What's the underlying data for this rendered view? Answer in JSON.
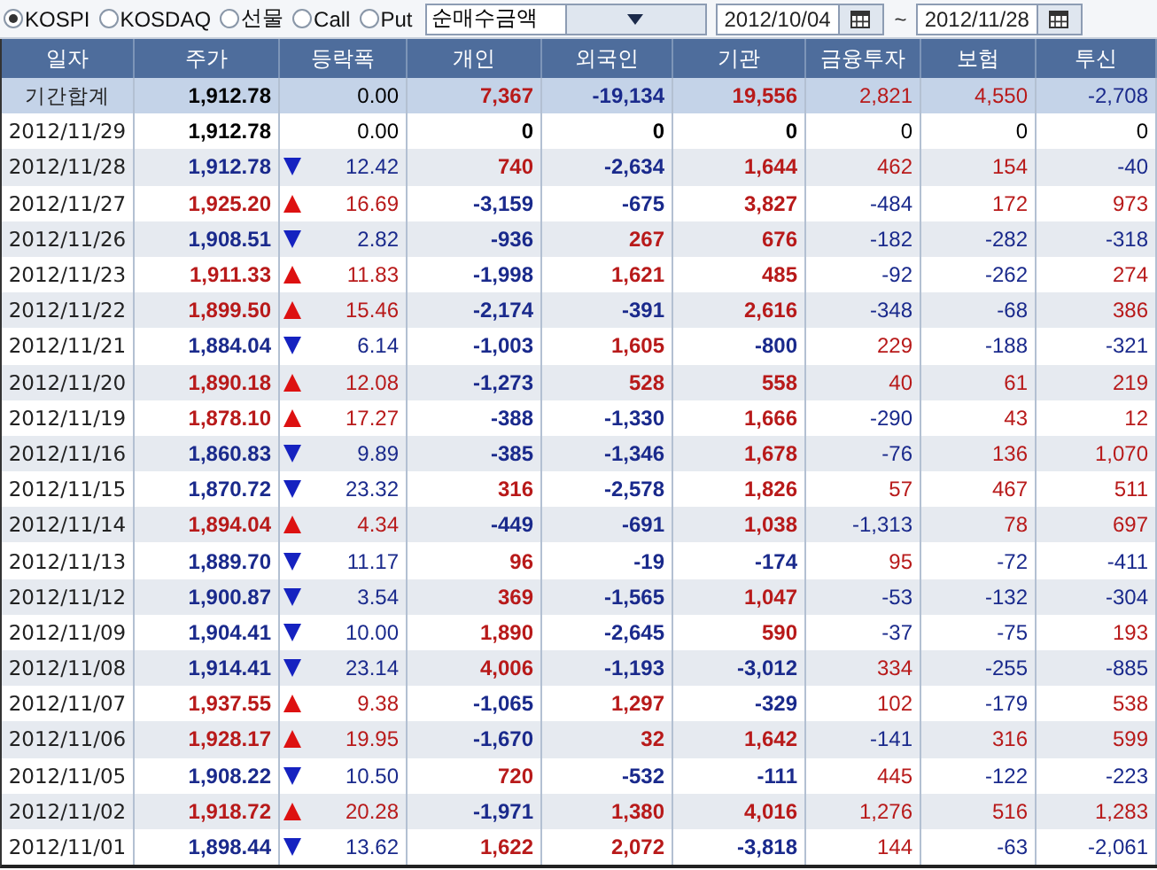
{
  "toolbar": {
    "markets": [
      {
        "label": "KOSPI",
        "selected": true
      },
      {
        "label": "KOSDAQ",
        "selected": false
      },
      {
        "label": "선물",
        "selected": false
      },
      {
        "label": "Call",
        "selected": false
      },
      {
        "label": "Put",
        "selected": false
      }
    ],
    "metric": "순매수금액",
    "date_from": "2012/10/04",
    "range_separator": "~",
    "date_to": "2012/11/28"
  },
  "table": {
    "columns": [
      "일자",
      "주가",
      "등락폭",
      "개인",
      "외국인",
      "기관",
      "금융투자",
      "보험",
      "투신"
    ],
    "rows": [
      {
        "kind": "total",
        "date": "기간합계",
        "price": {
          "value": "1,912.78",
          "color": "#000000"
        },
        "change": {
          "kind": "none",
          "value": "0.00",
          "color": "#000000"
        },
        "investors": [
          {
            "value": "7,367",
            "color": "#b81a1a"
          },
          {
            "value": "-19,134",
            "color": "#1a2a8c"
          },
          {
            "value": "19,556",
            "color": "#b81a1a"
          },
          {
            "value": "2,821",
            "color": "#b81a1a"
          },
          {
            "value": "4,550",
            "color": "#b81a1a"
          },
          {
            "value": "-2,708",
            "color": "#1a2a8c"
          }
        ]
      },
      {
        "kind": "day",
        "date": "2012/11/29",
        "price": {
          "value": "1,912.78",
          "color": "#000000"
        },
        "change": {
          "kind": "none",
          "value": "0.00",
          "color": "#000000"
        },
        "investors": [
          {
            "value": "0",
            "color": "#000000"
          },
          {
            "value": "0",
            "color": "#000000"
          },
          {
            "value": "0",
            "color": "#000000"
          },
          {
            "value": "0",
            "color": "#000000"
          },
          {
            "value": "0",
            "color": "#000000"
          },
          {
            "value": "0",
            "color": "#000000"
          }
        ]
      },
      {
        "kind": "day",
        "date": "2012/11/28",
        "price": {
          "value": "1,912.78",
          "color": "#1a2a8c"
        },
        "change": {
          "kind": "down",
          "value": "12.42",
          "color": "#1a2a8c"
        },
        "investors": [
          {
            "value": "740",
            "color": "#b81a1a"
          },
          {
            "value": "-2,634",
            "color": "#1a2a8c"
          },
          {
            "value": "1,644",
            "color": "#b81a1a"
          },
          {
            "value": "462",
            "color": "#b81a1a"
          },
          {
            "value": "154",
            "color": "#b81a1a"
          },
          {
            "value": "-40",
            "color": "#1a2a8c"
          }
        ]
      },
      {
        "kind": "day",
        "date": "2012/11/27",
        "price": {
          "value": "1,925.20",
          "color": "#b81a1a"
        },
        "change": {
          "kind": "up",
          "value": "16.69",
          "color": "#b81a1a"
        },
        "investors": [
          {
            "value": "-3,159",
            "color": "#1a2a8c"
          },
          {
            "value": "-675",
            "color": "#1a2a8c"
          },
          {
            "value": "3,827",
            "color": "#b81a1a"
          },
          {
            "value": "-484",
            "color": "#1a2a8c"
          },
          {
            "value": "172",
            "color": "#b81a1a"
          },
          {
            "value": "973",
            "color": "#b81a1a"
          }
        ]
      },
      {
        "kind": "day",
        "date": "2012/11/26",
        "price": {
          "value": "1,908.51",
          "color": "#1a2a8c"
        },
        "change": {
          "kind": "down",
          "value": "2.82",
          "color": "#1a2a8c"
        },
        "investors": [
          {
            "value": "-936",
            "color": "#1a2a8c"
          },
          {
            "value": "267",
            "color": "#b81a1a"
          },
          {
            "value": "676",
            "color": "#b81a1a"
          },
          {
            "value": "-182",
            "color": "#1a2a8c"
          },
          {
            "value": "-282",
            "color": "#1a2a8c"
          },
          {
            "value": "-318",
            "color": "#1a2a8c"
          }
        ]
      },
      {
        "kind": "day",
        "date": "2012/11/23",
        "price": {
          "value": "1,911.33",
          "color": "#b81a1a"
        },
        "change": {
          "kind": "up",
          "value": "11.83",
          "color": "#b81a1a"
        },
        "investors": [
          {
            "value": "-1,998",
            "color": "#1a2a8c"
          },
          {
            "value": "1,621",
            "color": "#b81a1a"
          },
          {
            "value": "485",
            "color": "#b81a1a"
          },
          {
            "value": "-92",
            "color": "#1a2a8c"
          },
          {
            "value": "-262",
            "color": "#1a2a8c"
          },
          {
            "value": "274",
            "color": "#b81a1a"
          }
        ]
      },
      {
        "kind": "day",
        "date": "2012/11/22",
        "price": {
          "value": "1,899.50",
          "color": "#b81a1a"
        },
        "change": {
          "kind": "up",
          "value": "15.46",
          "color": "#b81a1a"
        },
        "investors": [
          {
            "value": "-2,174",
            "color": "#1a2a8c"
          },
          {
            "value": "-391",
            "color": "#1a2a8c"
          },
          {
            "value": "2,616",
            "color": "#b81a1a"
          },
          {
            "value": "-348",
            "color": "#1a2a8c"
          },
          {
            "value": "-68",
            "color": "#1a2a8c"
          },
          {
            "value": "386",
            "color": "#b81a1a"
          }
        ]
      },
      {
        "kind": "day",
        "date": "2012/11/21",
        "price": {
          "value": "1,884.04",
          "color": "#1a2a8c"
        },
        "change": {
          "kind": "down",
          "value": "6.14",
          "color": "#1a2a8c"
        },
        "investors": [
          {
            "value": "-1,003",
            "color": "#1a2a8c"
          },
          {
            "value": "1,605",
            "color": "#b81a1a"
          },
          {
            "value": "-800",
            "color": "#1a2a8c"
          },
          {
            "value": "229",
            "color": "#b81a1a"
          },
          {
            "value": "-188",
            "color": "#1a2a8c"
          },
          {
            "value": "-321",
            "color": "#1a2a8c"
          }
        ]
      },
      {
        "kind": "day",
        "date": "2012/11/20",
        "price": {
          "value": "1,890.18",
          "color": "#b81a1a"
        },
        "change": {
          "kind": "up",
          "value": "12.08",
          "color": "#b81a1a"
        },
        "investors": [
          {
            "value": "-1,273",
            "color": "#1a2a8c"
          },
          {
            "value": "528",
            "color": "#b81a1a"
          },
          {
            "value": "558",
            "color": "#b81a1a"
          },
          {
            "value": "40",
            "color": "#b81a1a"
          },
          {
            "value": "61",
            "color": "#b81a1a"
          },
          {
            "value": "219",
            "color": "#b81a1a"
          }
        ]
      },
      {
        "kind": "day",
        "date": "2012/11/19",
        "price": {
          "value": "1,878.10",
          "color": "#b81a1a"
        },
        "change": {
          "kind": "up",
          "value": "17.27",
          "color": "#b81a1a"
        },
        "investors": [
          {
            "value": "-388",
            "color": "#1a2a8c"
          },
          {
            "value": "-1,330",
            "color": "#1a2a8c"
          },
          {
            "value": "1,666",
            "color": "#b81a1a"
          },
          {
            "value": "-290",
            "color": "#1a2a8c"
          },
          {
            "value": "43",
            "color": "#b81a1a"
          },
          {
            "value": "12",
            "color": "#b81a1a"
          }
        ]
      },
      {
        "kind": "day",
        "date": "2012/11/16",
        "price": {
          "value": "1,860.83",
          "color": "#1a2a8c"
        },
        "change": {
          "kind": "down",
          "value": "9.89",
          "color": "#1a2a8c"
        },
        "investors": [
          {
            "value": "-385",
            "color": "#1a2a8c"
          },
          {
            "value": "-1,346",
            "color": "#1a2a8c"
          },
          {
            "value": "1,678",
            "color": "#b81a1a"
          },
          {
            "value": "-76",
            "color": "#1a2a8c"
          },
          {
            "value": "136",
            "color": "#b81a1a"
          },
          {
            "value": "1,070",
            "color": "#b81a1a"
          }
        ]
      },
      {
        "kind": "day",
        "date": "2012/11/15",
        "price": {
          "value": "1,870.72",
          "color": "#1a2a8c"
        },
        "change": {
          "kind": "down",
          "value": "23.32",
          "color": "#1a2a8c"
        },
        "investors": [
          {
            "value": "316",
            "color": "#b81a1a"
          },
          {
            "value": "-2,578",
            "color": "#1a2a8c"
          },
          {
            "value": "1,826",
            "color": "#b81a1a"
          },
          {
            "value": "57",
            "color": "#b81a1a"
          },
          {
            "value": "467",
            "color": "#b81a1a"
          },
          {
            "value": "511",
            "color": "#b81a1a"
          }
        ]
      },
      {
        "kind": "day",
        "date": "2012/11/14",
        "price": {
          "value": "1,894.04",
          "color": "#b81a1a"
        },
        "change": {
          "kind": "up",
          "value": "4.34",
          "color": "#b81a1a"
        },
        "investors": [
          {
            "value": "-449",
            "color": "#1a2a8c"
          },
          {
            "value": "-691",
            "color": "#1a2a8c"
          },
          {
            "value": "1,038",
            "color": "#b81a1a"
          },
          {
            "value": "-1,313",
            "color": "#1a2a8c"
          },
          {
            "value": "78",
            "color": "#b81a1a"
          },
          {
            "value": "697",
            "color": "#b81a1a"
          }
        ]
      },
      {
        "kind": "day",
        "date": "2012/11/13",
        "price": {
          "value": "1,889.70",
          "color": "#1a2a8c"
        },
        "change": {
          "kind": "down",
          "value": "11.17",
          "color": "#1a2a8c"
        },
        "investors": [
          {
            "value": "96",
            "color": "#b81a1a"
          },
          {
            "value": "-19",
            "color": "#1a2a8c"
          },
          {
            "value": "-174",
            "color": "#1a2a8c"
          },
          {
            "value": "95",
            "color": "#b81a1a"
          },
          {
            "value": "-72",
            "color": "#1a2a8c"
          },
          {
            "value": "-411",
            "color": "#1a2a8c"
          }
        ]
      },
      {
        "kind": "day",
        "date": "2012/11/12",
        "price": {
          "value": "1,900.87",
          "color": "#1a2a8c"
        },
        "change": {
          "kind": "down",
          "value": "3.54",
          "color": "#1a2a8c"
        },
        "investors": [
          {
            "value": "369",
            "color": "#b81a1a"
          },
          {
            "value": "-1,565",
            "color": "#1a2a8c"
          },
          {
            "value": "1,047",
            "color": "#b81a1a"
          },
          {
            "value": "-53",
            "color": "#1a2a8c"
          },
          {
            "value": "-132",
            "color": "#1a2a8c"
          },
          {
            "value": "-304",
            "color": "#1a2a8c"
          }
        ]
      },
      {
        "kind": "day",
        "date": "2012/11/09",
        "price": {
          "value": "1,904.41",
          "color": "#1a2a8c"
        },
        "change": {
          "kind": "down",
          "value": "10.00",
          "color": "#1a2a8c"
        },
        "investors": [
          {
            "value": "1,890",
            "color": "#b81a1a"
          },
          {
            "value": "-2,645",
            "color": "#1a2a8c"
          },
          {
            "value": "590",
            "color": "#b81a1a"
          },
          {
            "value": "-37",
            "color": "#1a2a8c"
          },
          {
            "value": "-75",
            "color": "#1a2a8c"
          },
          {
            "value": "193",
            "color": "#b81a1a"
          }
        ]
      },
      {
        "kind": "day",
        "date": "2012/11/08",
        "price": {
          "value": "1,914.41",
          "color": "#1a2a8c"
        },
        "change": {
          "kind": "down",
          "value": "23.14",
          "color": "#1a2a8c"
        },
        "investors": [
          {
            "value": "4,006",
            "color": "#b81a1a"
          },
          {
            "value": "-1,193",
            "color": "#1a2a8c"
          },
          {
            "value": "-3,012",
            "color": "#1a2a8c"
          },
          {
            "value": "334",
            "color": "#b81a1a"
          },
          {
            "value": "-255",
            "color": "#1a2a8c"
          },
          {
            "value": "-885",
            "color": "#1a2a8c"
          }
        ]
      },
      {
        "kind": "day",
        "date": "2012/11/07",
        "price": {
          "value": "1,937.55",
          "color": "#b81a1a"
        },
        "change": {
          "kind": "up",
          "value": "9.38",
          "color": "#b81a1a"
        },
        "investors": [
          {
            "value": "-1,065",
            "color": "#1a2a8c"
          },
          {
            "value": "1,297",
            "color": "#b81a1a"
          },
          {
            "value": "-329",
            "color": "#1a2a8c"
          },
          {
            "value": "102",
            "color": "#b81a1a"
          },
          {
            "value": "-179",
            "color": "#1a2a8c"
          },
          {
            "value": "538",
            "color": "#b81a1a"
          }
        ]
      },
      {
        "kind": "day",
        "date": "2012/11/06",
        "price": {
          "value": "1,928.17",
          "color": "#b81a1a"
        },
        "change": {
          "kind": "up",
          "value": "19.95",
          "color": "#b81a1a"
        },
        "investors": [
          {
            "value": "-1,670",
            "color": "#1a2a8c"
          },
          {
            "value": "32",
            "color": "#b81a1a"
          },
          {
            "value": "1,642",
            "color": "#b81a1a"
          },
          {
            "value": "-141",
            "color": "#1a2a8c"
          },
          {
            "value": "316",
            "color": "#b81a1a"
          },
          {
            "value": "599",
            "color": "#b81a1a"
          }
        ]
      },
      {
        "kind": "day",
        "date": "2012/11/05",
        "price": {
          "value": "1,908.22",
          "color": "#1a2a8c"
        },
        "change": {
          "kind": "down",
          "value": "10.50",
          "color": "#1a2a8c"
        },
        "investors": [
          {
            "value": "720",
            "color": "#b81a1a"
          },
          {
            "value": "-532",
            "color": "#1a2a8c"
          },
          {
            "value": "-111",
            "color": "#1a2a8c"
          },
          {
            "value": "445",
            "color": "#b81a1a"
          },
          {
            "value": "-122",
            "color": "#1a2a8c"
          },
          {
            "value": "-223",
            "color": "#1a2a8c"
          }
        ]
      },
      {
        "kind": "day",
        "date": "2012/11/02",
        "price": {
          "value": "1,918.72",
          "color": "#b81a1a"
        },
        "change": {
          "kind": "up",
          "value": "20.28",
          "color": "#b81a1a"
        },
        "investors": [
          {
            "value": "-1,971",
            "color": "#1a2a8c"
          },
          {
            "value": "1,380",
            "color": "#b81a1a"
          },
          {
            "value": "4,016",
            "color": "#b81a1a"
          },
          {
            "value": "1,276",
            "color": "#b81a1a"
          },
          {
            "value": "516",
            "color": "#b81a1a"
          },
          {
            "value": "1,283",
            "color": "#b81a1a"
          }
        ]
      },
      {
        "kind": "day",
        "date": "2012/11/01",
        "price": {
          "value": "1,898.44",
          "color": "#1a2a8c"
        },
        "change": {
          "kind": "down",
          "value": "13.62",
          "color": "#1a2a8c"
        },
        "investors": [
          {
            "value": "1,622",
            "color": "#b81a1a"
          },
          {
            "value": "2,072",
            "color": "#b81a1a"
          },
          {
            "value": "-3,818",
            "color": "#1a2a8c"
          },
          {
            "value": "144",
            "color": "#b81a1a"
          },
          {
            "value": "-63",
            "color": "#1a2a8c"
          },
          {
            "value": "-2,061",
            "color": "#1a2a8c"
          }
        ]
      }
    ]
  }
}
